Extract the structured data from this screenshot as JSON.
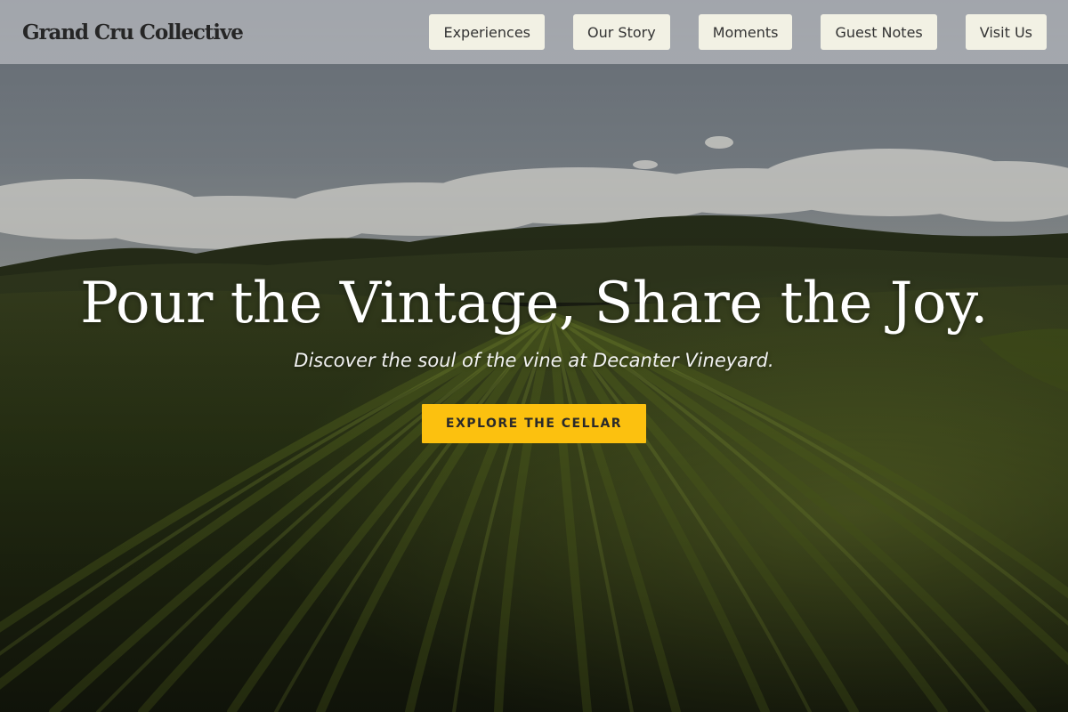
{
  "header": {
    "brand": "Grand Cru Collective",
    "nav_items": [
      {
        "label": "Experiences"
      },
      {
        "label": "Our Story"
      },
      {
        "label": "Moments"
      },
      {
        "label": "Guest Notes"
      },
      {
        "label": "Visit Us"
      }
    ]
  },
  "hero": {
    "title": "Pour the Vintage, Share the Joy.",
    "subtitle": "Discover the soul of the vine at Decanter Vineyard.",
    "cta_label": "EXPLORE THE CELLAR"
  },
  "colors": {
    "header_bg": "#c8cace",
    "nav_button_bg": "#f2f1e4",
    "cta_bg": "#fcc10f",
    "title_text": "#ffffff"
  }
}
